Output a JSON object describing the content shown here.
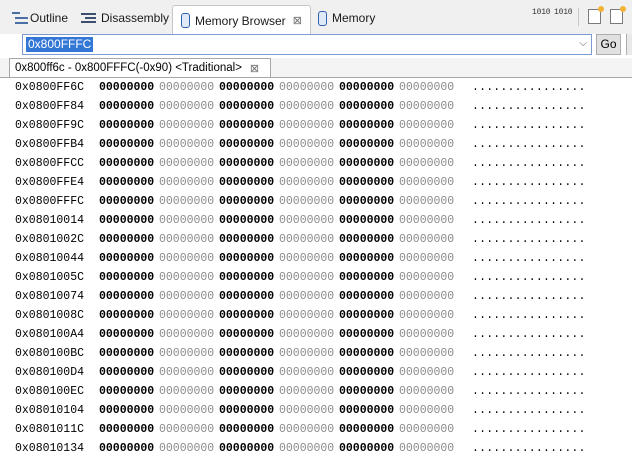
{
  "tabs": [
    {
      "label": "Outline",
      "icon": "outline-icon"
    },
    {
      "label": "Disassembly",
      "icon": "disassembly-icon"
    },
    {
      "label": "Memory Browser",
      "icon": "memory-icon",
      "active": true
    },
    {
      "label": "Memory",
      "icon": "memory-icon"
    }
  ],
  "toolbar": {
    "radix_label_1": "1010",
    "radix_label_2": "1010",
    "close_glyph": "⊠"
  },
  "address_bar": {
    "value": "0x800FFFC",
    "go_label": "Go"
  },
  "rendering": {
    "tab_label": "0x800ff6c - 0x800FFFC(-0x90) <Traditional>"
  },
  "memory": {
    "rows": [
      {
        "address": "0x0800FF6C",
        "words": [
          "00000000",
          "00000000",
          "00000000",
          "00000000",
          "00000000",
          "00000000"
        ],
        "ascii": "................"
      },
      {
        "address": "0x0800FF84",
        "words": [
          "00000000",
          "00000000",
          "00000000",
          "00000000",
          "00000000",
          "00000000"
        ],
        "ascii": "................"
      },
      {
        "address": "0x0800FF9C",
        "words": [
          "00000000",
          "00000000",
          "00000000",
          "00000000",
          "00000000",
          "00000000"
        ],
        "ascii": "................"
      },
      {
        "address": "0x0800FFB4",
        "words": [
          "00000000",
          "00000000",
          "00000000",
          "00000000",
          "00000000",
          "00000000"
        ],
        "ascii": "................"
      },
      {
        "address": "0x0800FFCC",
        "words": [
          "00000000",
          "00000000",
          "00000000",
          "00000000",
          "00000000",
          "00000000"
        ],
        "ascii": "................"
      },
      {
        "address": "0x0800FFE4",
        "words": [
          "00000000",
          "00000000",
          "00000000",
          "00000000",
          "00000000",
          "00000000"
        ],
        "ascii": "................"
      },
      {
        "address": "0x0800FFFC",
        "words": [
          "00000000",
          "00000000",
          "00000000",
          "00000000",
          "00000000",
          "00000000"
        ],
        "ascii": "................"
      },
      {
        "address": "0x08010014",
        "words": [
          "00000000",
          "00000000",
          "00000000",
          "00000000",
          "00000000",
          "00000000"
        ],
        "ascii": "................"
      },
      {
        "address": "0x0801002C",
        "words": [
          "00000000",
          "00000000",
          "00000000",
          "00000000",
          "00000000",
          "00000000"
        ],
        "ascii": "................"
      },
      {
        "address": "0x08010044",
        "words": [
          "00000000",
          "00000000",
          "00000000",
          "00000000",
          "00000000",
          "00000000"
        ],
        "ascii": "................"
      },
      {
        "address": "0x0801005C",
        "words": [
          "00000000",
          "00000000",
          "00000000",
          "00000000",
          "00000000",
          "00000000"
        ],
        "ascii": "................"
      },
      {
        "address": "0x08010074",
        "words": [
          "00000000",
          "00000000",
          "00000000",
          "00000000",
          "00000000",
          "00000000"
        ],
        "ascii": "................"
      },
      {
        "address": "0x0801008C",
        "words": [
          "00000000",
          "00000000",
          "00000000",
          "00000000",
          "00000000",
          "00000000"
        ],
        "ascii": "................"
      },
      {
        "address": "0x080100A4",
        "words": [
          "00000000",
          "00000000",
          "00000000",
          "00000000",
          "00000000",
          "00000000"
        ],
        "ascii": "................"
      },
      {
        "address": "0x080100BC",
        "words": [
          "00000000",
          "00000000",
          "00000000",
          "00000000",
          "00000000",
          "00000000"
        ],
        "ascii": "................"
      },
      {
        "address": "0x080100D4",
        "words": [
          "00000000",
          "00000000",
          "00000000",
          "00000000",
          "00000000",
          "00000000"
        ],
        "ascii": "................"
      },
      {
        "address": "0x080100EC",
        "words": [
          "00000000",
          "00000000",
          "00000000",
          "00000000",
          "00000000",
          "00000000"
        ],
        "ascii": "................"
      },
      {
        "address": "0x08010104",
        "words": [
          "00000000",
          "00000000",
          "00000000",
          "00000000",
          "00000000",
          "00000000"
        ],
        "ascii": "................"
      },
      {
        "address": "0x0801011C",
        "words": [
          "00000000",
          "00000000",
          "00000000",
          "00000000",
          "00000000",
          "00000000"
        ],
        "ascii": "................"
      },
      {
        "address": "0x08010134",
        "words": [
          "00000000",
          "00000000",
          "00000000",
          "00000000",
          "00000000",
          "00000000"
        ],
        "ascii": "................"
      }
    ]
  }
}
